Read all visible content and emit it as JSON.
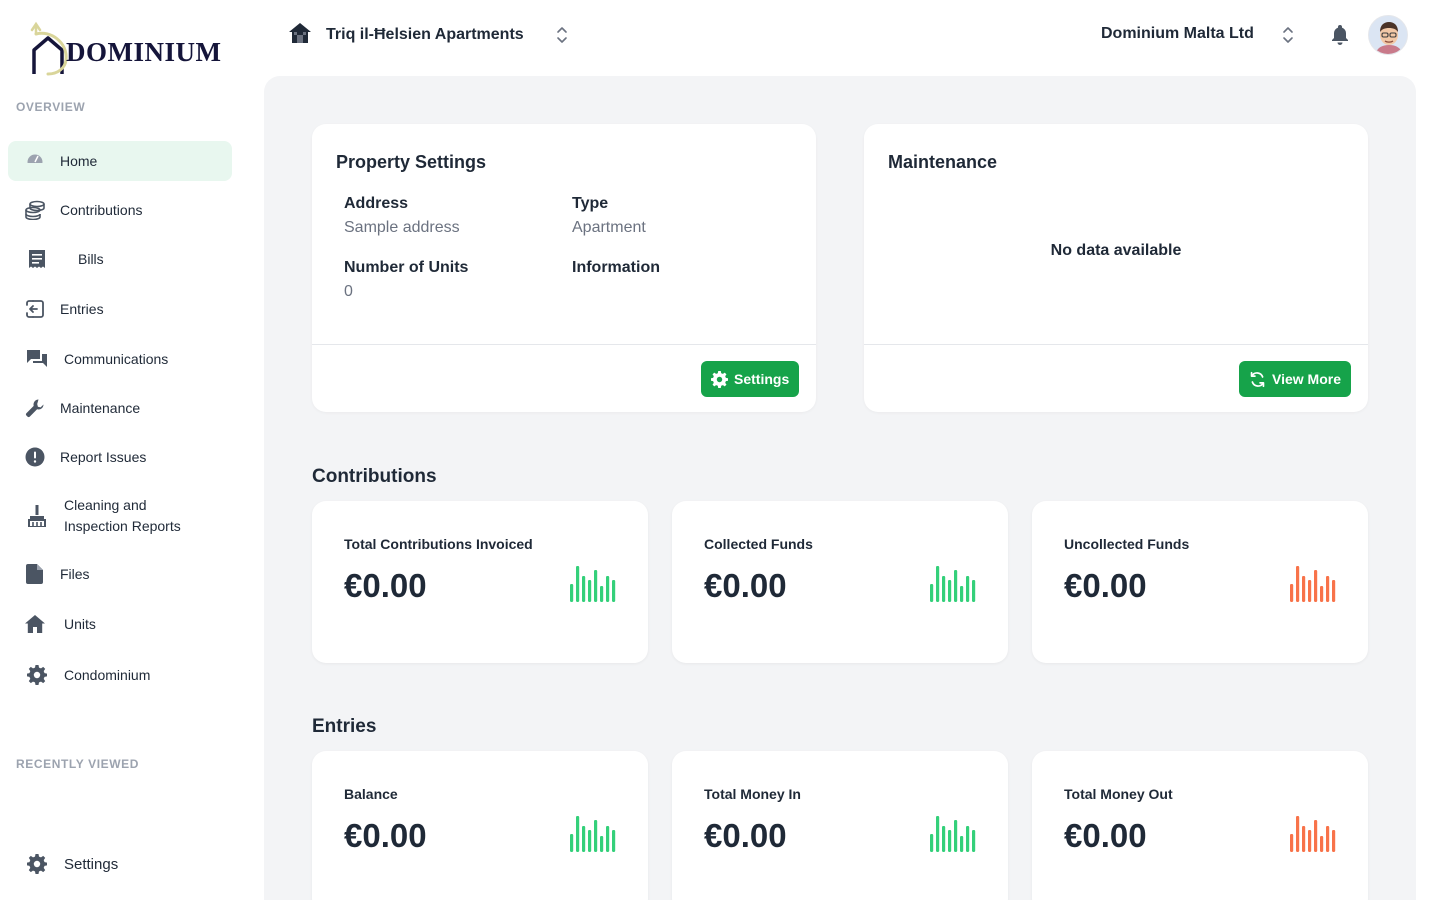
{
  "brand": {
    "name": "DOMINIUM"
  },
  "sidebar": {
    "overview_label": "OVERVIEW",
    "recent_label": "RECENTLY VIEWED",
    "items": [
      {
        "label": "Home",
        "icon": "gauge-icon",
        "active": true
      },
      {
        "label": "Contributions",
        "icon": "coins-stack-icon"
      },
      {
        "label": "Bills",
        "icon": "receipt-icon"
      },
      {
        "label": "Entries",
        "icon": "sign-in-icon"
      },
      {
        "label": "Communications",
        "icon": "chat-bubbles-icon"
      },
      {
        "label": "Maintenance",
        "icon": "wrench-icon"
      },
      {
        "label": "Report Issues",
        "icon": "exclamation-circle-icon"
      },
      {
        "label": "Cleaning and Inspection Reports",
        "icon": "broom-icon"
      },
      {
        "label": "Files",
        "icon": "file-icon"
      },
      {
        "label": "Units",
        "icon": "house-icon"
      },
      {
        "label": "Condominium",
        "icon": "gear-icon"
      }
    ],
    "settings_label": "Settings"
  },
  "topbar": {
    "property_name": "Triq il-Ħelsien Apartments",
    "organization_name": "Dominium Malta Ltd"
  },
  "property_settings": {
    "title": "Property Settings",
    "address_label": "Address",
    "address_value": "Sample address",
    "type_label": "Type",
    "type_value": "Apartment",
    "units_label": "Number of Units",
    "units_value": "0",
    "information_label": "Information",
    "button_label": "Settings"
  },
  "maintenance": {
    "title": "Maintenance",
    "empty_text": "No data available",
    "button_label": "View More"
  },
  "contributions": {
    "title": "Contributions",
    "cards": [
      {
        "label": "Total Contributions Invoiced",
        "value": "€0.00",
        "trend": "green"
      },
      {
        "label": "Collected Funds",
        "value": "€0.00",
        "trend": "green"
      },
      {
        "label": "Uncollected Funds",
        "value": "€0.00",
        "trend": "red"
      }
    ]
  },
  "entries": {
    "title": "Entries",
    "cards": [
      {
        "label": "Balance",
        "value": "€0.00",
        "trend": "green"
      },
      {
        "label": "Total Money In",
        "value": "€0.00",
        "trend": "green"
      },
      {
        "label": "Total Money Out",
        "value": "€0.00",
        "trend": "red"
      }
    ]
  },
  "colors": {
    "accent_green": "#16a34a",
    "spark_green": "#34d07a",
    "spark_red": "#f8734a",
    "active_bg": "#e8f7ef"
  }
}
